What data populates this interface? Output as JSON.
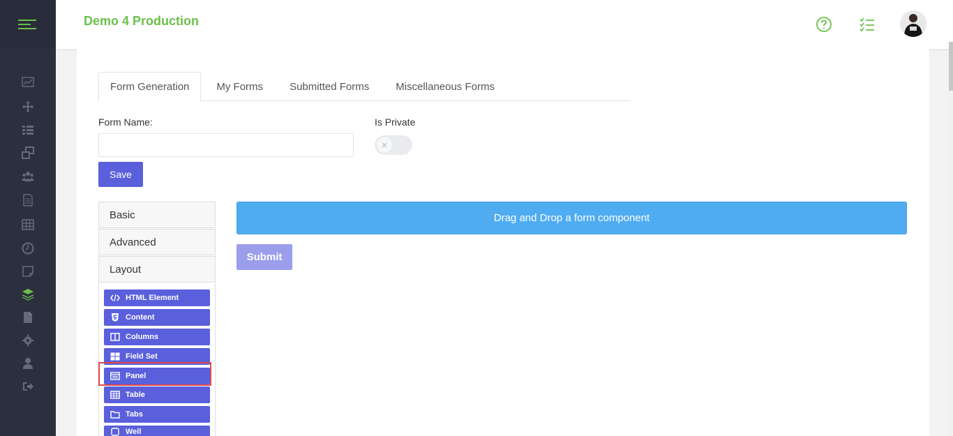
{
  "header": {
    "app_title": "Demo 4 Production",
    "icons": [
      "help-circle-icon",
      "checklist-icon",
      "avatar"
    ]
  },
  "sidebar": {
    "items": [
      {
        "icon": "chart-line-icon"
      },
      {
        "icon": "move-arrows-icon"
      },
      {
        "icon": "list-icon"
      },
      {
        "icon": "windows-icon"
      },
      {
        "icon": "users-icon"
      },
      {
        "icon": "document-icon"
      },
      {
        "icon": "table-icon"
      },
      {
        "icon": "clock-icon"
      },
      {
        "icon": "note-icon"
      },
      {
        "icon": "layers-icon",
        "active": true
      },
      {
        "icon": "file-icon"
      },
      {
        "icon": "gear-icon"
      },
      {
        "icon": "user-icon"
      },
      {
        "icon": "logout-icon"
      }
    ]
  },
  "tabs": [
    {
      "label": "Form Generation",
      "active": true
    },
    {
      "label": "My Forms"
    },
    {
      "label": "Submitted Forms"
    },
    {
      "label": "Miscellaneous Forms"
    }
  ],
  "form": {
    "name_label": "Form Name:",
    "name_value": "",
    "private_label": "Is Private",
    "private_on": false,
    "save_label": "Save"
  },
  "builder": {
    "groups": [
      "Basic",
      "Advanced",
      "Layout"
    ],
    "components": [
      {
        "label": "HTML Element",
        "icon": "code-icon"
      },
      {
        "label": "Content",
        "icon": "html5-icon"
      },
      {
        "label": "Columns",
        "icon": "columns-icon"
      },
      {
        "label": "Field Set",
        "icon": "grid-icon"
      },
      {
        "label": "Panel",
        "icon": "panel-icon",
        "highlighted": true
      },
      {
        "label": "Table",
        "icon": "table-icon"
      },
      {
        "label": "Tabs",
        "icon": "folder-icon"
      },
      {
        "label": "Well",
        "icon": "square-icon"
      }
    ]
  },
  "canvas": {
    "dropzone_text": "Drag and Drop a form component",
    "submit_label": "Submit"
  },
  "colors": {
    "brand_green": "#6cc04a",
    "primary": "#5a5fdc",
    "dropzone": "#4facf1",
    "sidebar_bg": "#2c2f3e"
  }
}
